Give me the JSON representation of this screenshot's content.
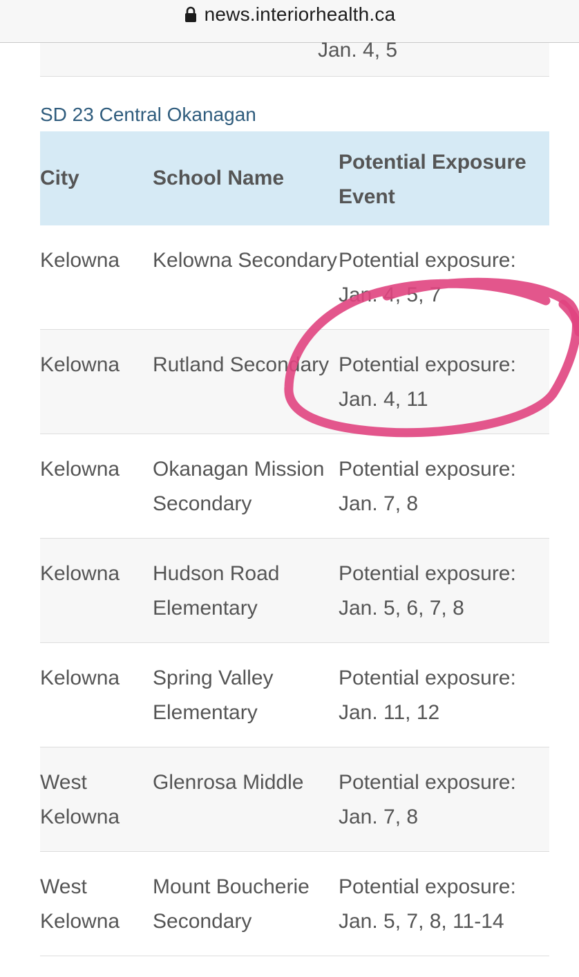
{
  "browser": {
    "url": "news.interiorhealth.ca"
  },
  "previous_row_text": "Jan. 4, 5",
  "section": {
    "title": "SD 23 Central Okanagan",
    "headers": {
      "city": "City",
      "school": "School Name",
      "event": "Potential Exposure Event"
    },
    "rows": [
      {
        "city": "Kelowna",
        "school": "Kelowna Secondary",
        "event": "Potential exposure: Jan. 4, 5, 7"
      },
      {
        "city": "Kelowna",
        "school": "Rutland Secondary",
        "event": "Potential exposure: Jan. 4, 11"
      },
      {
        "city": "Kelowna",
        "school": "Okanagan Mission Secondary",
        "event": "Potential exposure: Jan. 7, 8"
      },
      {
        "city": "Kelowna",
        "school": "Hudson Road Elementary",
        "event": "Potential exposure: Jan. 5, 6, 7, 8"
      },
      {
        "city": "Kelowna",
        "school": "Spring Valley Elementary",
        "event": "Potential exposure: Jan. 11, 12"
      },
      {
        "city": "West Kelowna",
        "school": "Glenrosa Middle",
        "event": "Potential exposure: Jan. 7, 8"
      },
      {
        "city": "West Kelowna",
        "school": "Mount Boucherie Secondary",
        "event": "Potential exposure: Jan. 5, 7, 8, 11-14"
      }
    ]
  },
  "icons": {
    "lock": "lock-icon"
  },
  "colors": {
    "header_bg": "#d6eaf5",
    "section_title": "#2f5c7d",
    "annotation": "#e0447f"
  }
}
